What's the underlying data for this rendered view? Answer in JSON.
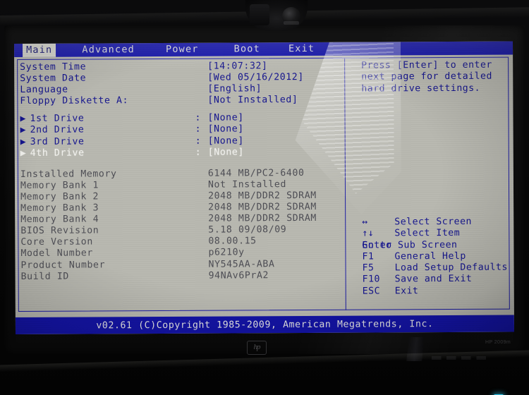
{
  "monitor": {
    "brand_logo": "hp",
    "model_label": "HP 2009m",
    "power_led": "#2fc4e8"
  },
  "bios": {
    "menubar": {
      "tabs": [
        {
          "label": "Main",
          "active": true
        },
        {
          "label": "Advanced",
          "active": false
        },
        {
          "label": "Power",
          "active": false
        },
        {
          "label": "Boot",
          "active": false
        },
        {
          "label": "Exit",
          "active": false
        }
      ]
    },
    "settings": [
      {
        "label": "System Time",
        "colon": "",
        "value": "[14:07:32]",
        "state": "normal",
        "arrow": ""
      },
      {
        "label": "System Date",
        "colon": "",
        "value": "[Wed 05/16/2012]",
        "state": "normal",
        "arrow": ""
      },
      {
        "label": "Language",
        "colon": "",
        "value": "[English]",
        "state": "normal",
        "arrow": ""
      },
      {
        "label": "Floppy Diskette A:",
        "colon": "",
        "value": "[Not Installed]",
        "state": "normal",
        "arrow": ""
      },
      {
        "label": "1st Drive",
        "colon": ":",
        "value": "[None]",
        "state": "normal",
        "arrow": "▶"
      },
      {
        "label": "2nd Drive",
        "colon": ":",
        "value": "[None]",
        "state": "normal",
        "arrow": "▶"
      },
      {
        "label": "3rd Drive",
        "colon": ":",
        "value": "[None]",
        "state": "normal",
        "arrow": "▶"
      },
      {
        "label": "4th Drive",
        "colon": ":",
        "value": "[None]",
        "state": "selected",
        "arrow": "▶"
      },
      {
        "label": "Installed Memory",
        "colon": "",
        "value": "6144 MB/PC2-6400",
        "state": "dim",
        "arrow": ""
      },
      {
        "label": "Memory Bank 1",
        "colon": "",
        "value": "Not Installed",
        "state": "dim",
        "arrow": ""
      },
      {
        "label": "Memory Bank 2",
        "colon": "",
        "value": "2048 MB/DDR2 SDRAM",
        "state": "dim",
        "arrow": ""
      },
      {
        "label": "Memory Bank 3",
        "colon": "",
        "value": "2048 MB/DDR2 SDRAM",
        "state": "dim",
        "arrow": ""
      },
      {
        "label": "Memory Bank 4",
        "colon": "",
        "value": "2048 MB/DDR2 SDRAM",
        "state": "dim",
        "arrow": ""
      },
      {
        "label": "BIOS Revision",
        "colon": "",
        "value": "5.18 09/08/09",
        "state": "dim",
        "arrow": ""
      },
      {
        "label": "Core Version",
        "colon": "",
        "value": "08.00.15",
        "state": "dim",
        "arrow": ""
      },
      {
        "label": "Model Number",
        "colon": "",
        "value": "p6210y",
        "state": "dim",
        "arrow": ""
      },
      {
        "label": "Product Number",
        "colon": "",
        "value": "NY545AA-ABA",
        "state": "dim",
        "arrow": ""
      },
      {
        "label": "Build ID",
        "colon": "",
        "value": "94NAv6PrA2",
        "state": "dim",
        "arrow": ""
      }
    ],
    "help": {
      "text": "Press [Enter] to enter next page for detailed hard drive settings."
    },
    "keys": [
      {
        "key": "↔",
        "desc": "Select Screen"
      },
      {
        "key": "↑↓",
        "desc": "Select Item"
      },
      {
        "key": "Enter",
        "desc": "Go to Sub Screen"
      },
      {
        "key": "F1",
        "desc": "General Help"
      },
      {
        "key": "F5",
        "desc": "Load Setup Defaults"
      },
      {
        "key": "F10",
        "desc": "Save and Exit"
      },
      {
        "key": "ESC",
        "desc": "Exit"
      }
    ],
    "statusbar": {
      "text": "v02.61 (C)Copyright 1985-2009, American Megatrends, Inc."
    }
  }
}
